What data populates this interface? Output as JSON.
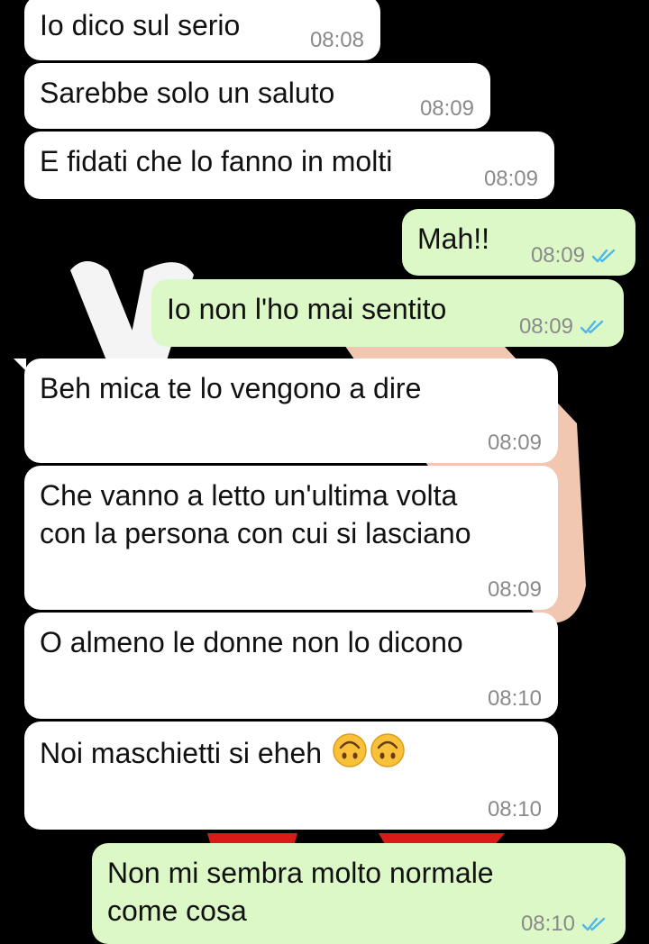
{
  "messages": [
    {
      "text": "Io dico sul serio",
      "time": "08:08",
      "direction": "in"
    },
    {
      "text": "Sarebbe solo un saluto",
      "time": "08:09",
      "direction": "in"
    },
    {
      "text": "E fidati che lo fanno in molti",
      "time": "08:09",
      "direction": "in"
    },
    {
      "text": "Mah!!",
      "time": "08:09",
      "direction": "out",
      "status_icon": "double-check-read-icon"
    },
    {
      "text": "Io non l'ho mai sentito",
      "time": "08:09",
      "direction": "out",
      "status_icon": "double-check-read-icon"
    },
    {
      "text": "Beh mica te lo vengono a dire",
      "time": "08:09",
      "direction": "in"
    },
    {
      "text": "Che vanno a letto un'ultima volta\ncon la persona con cui si lasciano",
      "time": "08:09",
      "direction": "in"
    },
    {
      "text": "O almeno le donne non lo dicono",
      "time": "08:10",
      "direction": "in"
    },
    {
      "text": "Noi maschietti si eheh",
      "time": "08:10",
      "direction": "in",
      "emojis": [
        "upside-down-face-icon",
        "upside-down-face-icon"
      ]
    },
    {
      "text": "Non mi sembra molto normale\ncome cosa",
      "time": "08:10",
      "direction": "out",
      "status_icon": "double-check-read-icon"
    }
  ],
  "colors": {
    "incoming_bubble": "#ffffff",
    "outgoing_bubble": "#dcf8c6",
    "timestamp": "#8a8a8a",
    "read_tick": "#4fb6ec",
    "background": "#000000"
  }
}
